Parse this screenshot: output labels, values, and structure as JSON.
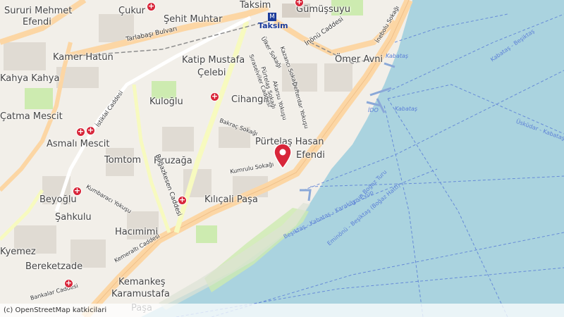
{
  "districts": [
    {
      "id": "sururi",
      "text": "Sururi Mehmet"
    },
    {
      "id": "efendi",
      "text": "Efendi"
    },
    {
      "id": "cukur",
      "text": "Çukur"
    },
    {
      "id": "sehit",
      "text": "Şehit Muhtar"
    },
    {
      "id": "taksim",
      "text": "Taksim"
    },
    {
      "id": "gumussuyu",
      "text": "Gümüşsuyu"
    },
    {
      "id": "kamer",
      "text": "Kamer Hatun"
    },
    {
      "id": "katip",
      "text": "Katip Mustafa"
    },
    {
      "id": "celebi",
      "text": "Çelebi"
    },
    {
      "id": "omer",
      "text": "Ömer Avni"
    },
    {
      "id": "kahya",
      "text": "Kahya Kahya"
    },
    {
      "id": "kuloglu",
      "text": "Kuloğlu"
    },
    {
      "id": "cihangir",
      "text": "Cihangir"
    },
    {
      "id": "catma",
      "text": "Çatma Mescit"
    },
    {
      "id": "asmali",
      "text": "Asmalı Mescit"
    },
    {
      "id": "purtelas",
      "text": "Pürtelaş Hasan"
    },
    {
      "id": "efendi2",
      "text": "Efendi"
    },
    {
      "id": "tomtom",
      "text": "Tomtom"
    },
    {
      "id": "firuzaga",
      "text": "Firuzağa"
    },
    {
      "id": "beyoglu",
      "text": "Beyoğlu"
    },
    {
      "id": "kilicali",
      "text": "Kılıçali Paşa"
    },
    {
      "id": "sahkulu",
      "text": "Şahkulu"
    },
    {
      "id": "hacimimi",
      "text": "Hacımimi"
    },
    {
      "id": "kemankes",
      "text": "Kemankeş"
    },
    {
      "id": "karamustafa",
      "text": "Karamustafa"
    },
    {
      "id": "pasa",
      "text": "Paşa"
    },
    {
      "id": "bereketzade",
      "text": "Bereketzade"
    },
    {
      "id": "keyemez",
      "text": "Kyemez"
    }
  ],
  "streets": {
    "tarlabasi": "Tarlabaşı Bulvarı",
    "inonu": "İnönü Caddesi",
    "istiklal": "İstiklal Caddesi",
    "bogazkesen": "Boğazkesen Caddesi",
    "kemeralti": "Kemeraltı Caddesi",
    "bankalar": "Bankalar Caddesi",
    "kumbaraci": "Kumbaracı Yokuşu",
    "kumrulu": "Kumrulu Sokağı",
    "bakrac": "Bakraç Sokağı",
    "siraselviler": "Sıraselviler Caddesi",
    "ulker": "Ülker Sokağı",
    "kazanci": "Kazancı Sokağı",
    "purtelas_sk": "Pürtelaş Sokağı",
    "akarsu": "Akarsu Yokuşu",
    "defterdar": "Defterdar Yokuşu",
    "inebolu": "İnebolu Sokağı",
    "kabatas_sk": "Kabataş Sokağı"
  },
  "places": {
    "taksim_metro": "Taksim",
    "kabatas1": "Kabataş",
    "kabatas2": "Kabataş",
    "ido": "İDO"
  },
  "ferry_routes": {
    "besiktas_kabatas": "Beşiktaş - Kabataş - Karaköy - Eyüp",
    "uzun_bogaz": "Uzun Boğaz Turu",
    "eminonu": "Eminönü - Beşiktaş (Boğaz Hattı)",
    "uskudar_kabatas": "Üsküdar - Kabataş",
    "uskudar_besiktas": "Kabataş - Beşiktaş"
  },
  "attribution": "(c) OpenStreetMap katkicilari",
  "colors": {
    "water": "#aad3df",
    "land": "#f2efe9",
    "primary_road": "#fcd6a4",
    "secondary_road": "#f7fabf",
    "marker": "#d8263a"
  }
}
